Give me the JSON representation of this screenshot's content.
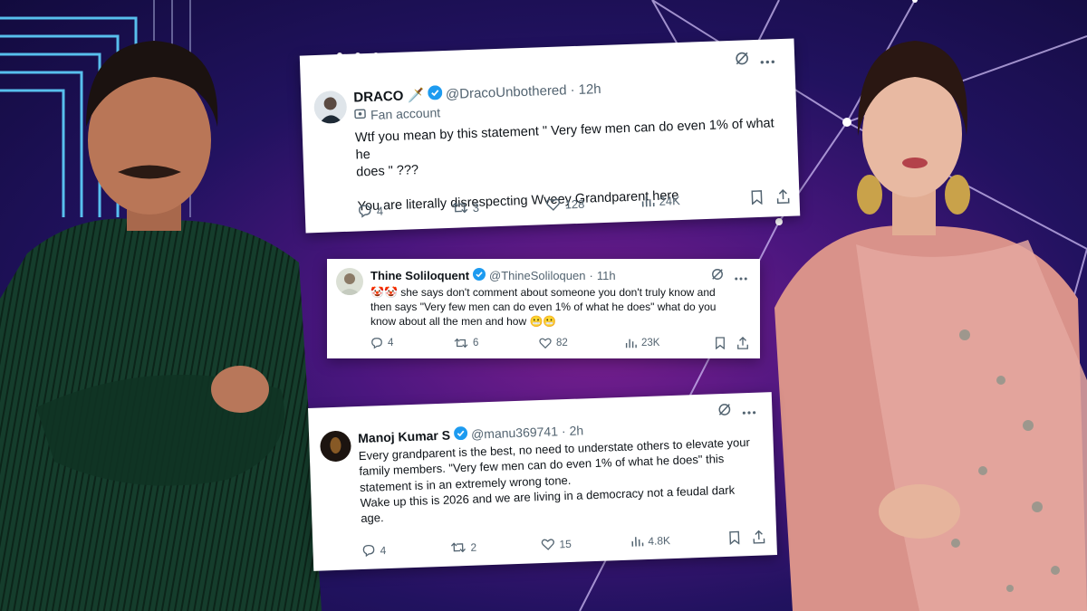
{
  "tweets": [
    {
      "name": "DRACO",
      "name_emoji": "🗡️",
      "handle": "@DracoUnbothered",
      "time": "12h",
      "label": "Fan account",
      "text_lines": [
        "Wtf you mean by this statement \" Very few men can do even 1% of what he",
        "does \" ???",
        "",
        "You are literally disrespecting Wveey Grandparent here"
      ],
      "replies": "4",
      "reposts": "3",
      "likes": "128",
      "views": "24K"
    },
    {
      "name": "Thine Soliloquent",
      "handle": "@ThineSoliloquen",
      "time": "11h",
      "text_lines": [
        "🤡🤡 she says don't comment about someone you don't truly know and",
        "then says \"Very few men can do even 1% of what he does\" what do you",
        "know about all the men and how 😬😬"
      ],
      "replies": "4",
      "reposts": "6",
      "likes": "82",
      "views": "23K"
    },
    {
      "name": "Manoj Kumar S",
      "handle": "@manu369741",
      "time": "2h",
      "text_lines": [
        "Every grandparent is the best, no need to understate others to elevate your",
        "family members. \"Very few men can do even 1% of what he does\" this",
        "statement is in an extremely wrong tone.",
        "Wake up this is 2026 and we are living in a democracy not a feudal dark",
        "age."
      ],
      "replies": "4",
      "reposts": "2",
      "likes": "15",
      "views": "4.8K"
    }
  ],
  "separator": "·",
  "colors": {
    "verified_blue": "#1d9bf0",
    "card_bg": "#ffffff",
    "text": "#0f1419",
    "secondary_text": "#536471"
  }
}
